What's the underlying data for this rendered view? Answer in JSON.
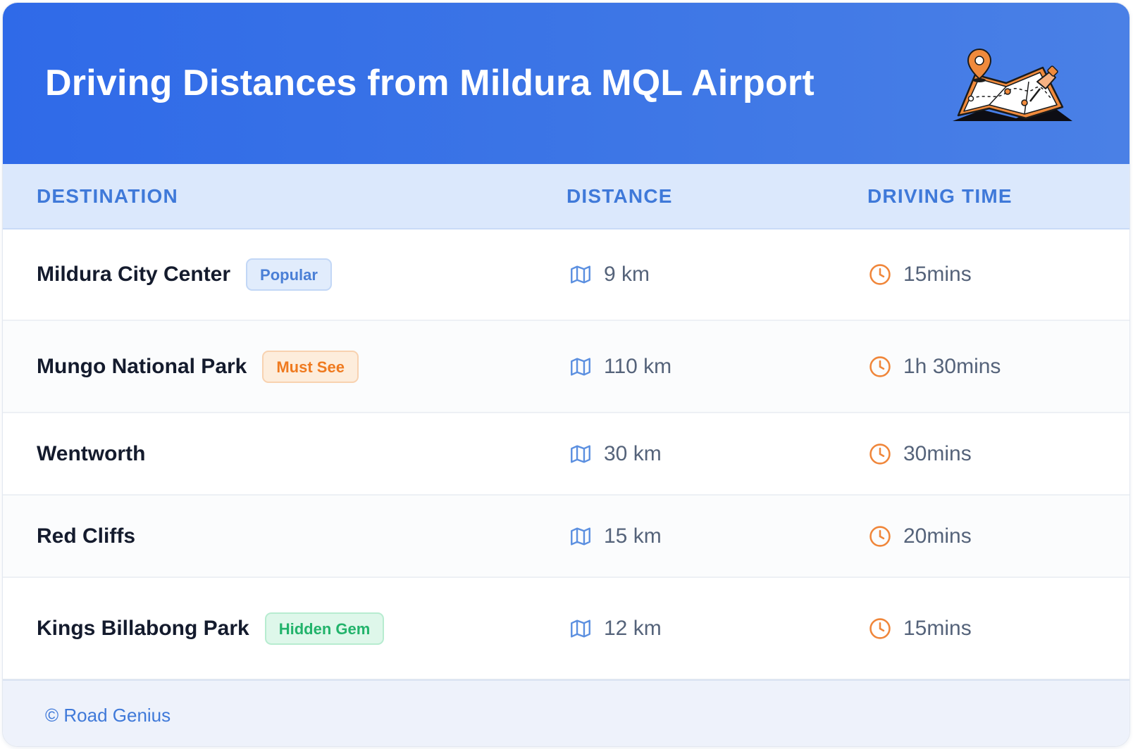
{
  "header": {
    "title": "Driving Distances from Mildura MQL Airport",
    "illustration_icon": "folded-map-with-pins-icon"
  },
  "table": {
    "columns": [
      "DESTINATION",
      "DISTANCE",
      "DRIVING TIME"
    ],
    "rows": [
      {
        "destination": "Mildura City Center",
        "badge": "Popular",
        "distance": "9 km",
        "time": "15mins"
      },
      {
        "destination": "Mungo National Park",
        "badge": "Must See",
        "distance": "110 km",
        "time": "1h 30mins"
      },
      {
        "destination": "Wentworth",
        "badge": "",
        "distance": "30 km",
        "time": "30mins"
      },
      {
        "destination": "Red Cliffs",
        "badge": "",
        "distance": "15 km",
        "time": "20mins"
      },
      {
        "destination": "Kings Billabong Park",
        "badge": "Hidden Gem",
        "distance": "12 km",
        "time": "15mins"
      }
    ]
  },
  "icons": {
    "distance": "map-icon",
    "time": "clock-icon"
  },
  "footer": {
    "text": "© Road Genius"
  },
  "colors": {
    "header_gradient_start": "#2f6ae8",
    "header_gradient_end": "#4a80e6",
    "table_header_bg": "#dbe8fc",
    "accent_blue": "#3f79d9",
    "accent_orange": "#ef7a1f",
    "accent_green": "#22b36b"
  }
}
